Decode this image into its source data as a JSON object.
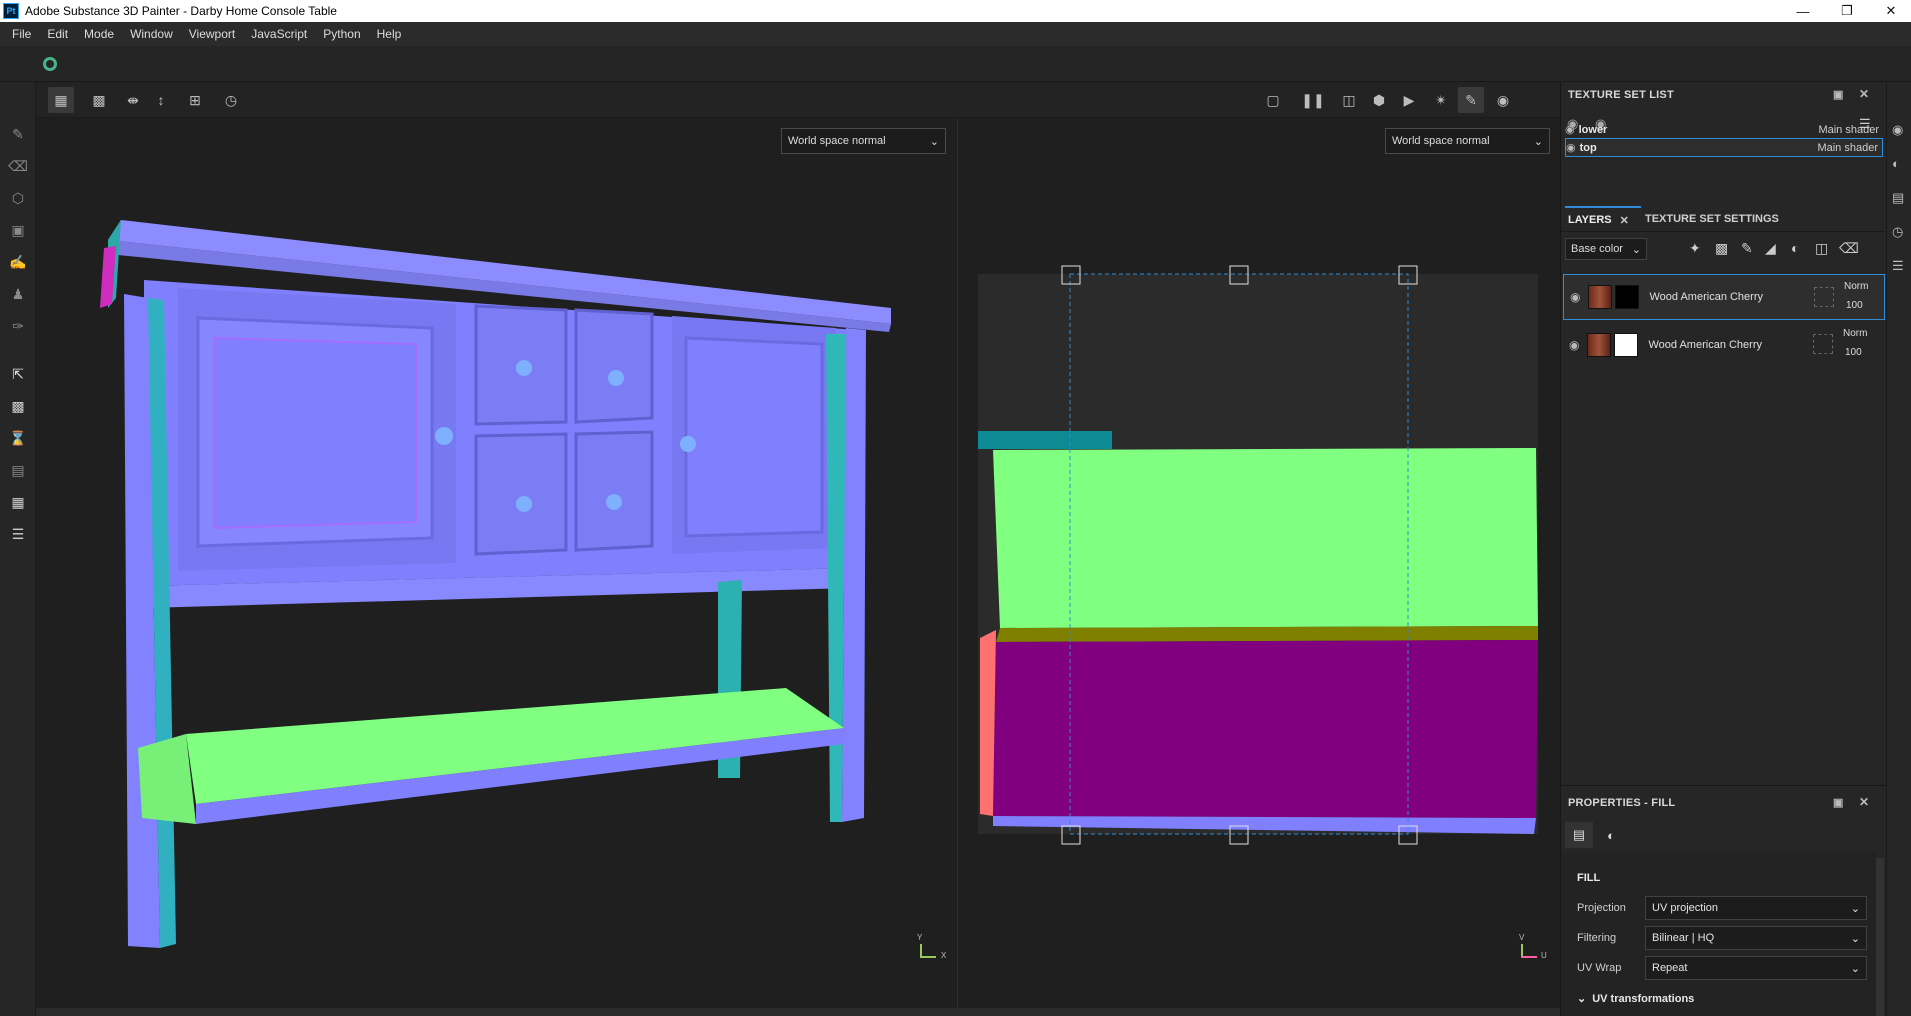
{
  "app": {
    "title": "Adobe Substance 3D Painter - Darby Home Console Table",
    "logo_text": "Pt"
  },
  "menu": [
    "File",
    "Edit",
    "Mode",
    "Window",
    "Viewport",
    "JavaScript",
    "Python",
    "Help"
  ],
  "viewports": {
    "left_mode": "World space normal",
    "right_mode": "World space normal",
    "axis_left": {
      "y": "Y",
      "x": "X"
    },
    "axis_right": {
      "y": "V",
      "x": "U"
    }
  },
  "texture_set_list": {
    "title": "TEXTURE SET LIST",
    "items": [
      {
        "name": "lower",
        "shader": "Main shader",
        "selected": false
      },
      {
        "name": "top",
        "shader": "Main shader",
        "selected": true
      }
    ]
  },
  "layers": {
    "tab_layers": "LAYERS",
    "tab_settings": "TEXTURE SET SETTINGS",
    "channel": "Base color",
    "items": [
      {
        "name": "Wood American Cherry",
        "blend": "Norm",
        "opacity": "100",
        "mask": "black",
        "selected": true
      },
      {
        "name": "Wood American Cherry",
        "blend": "Norm",
        "opacity": "100",
        "mask": "white",
        "selected": false
      }
    ]
  },
  "properties": {
    "title": "PROPERTIES - FILL",
    "section": "FILL",
    "rows": [
      {
        "label": "Projection",
        "value": "UV projection"
      },
      {
        "label": "Filtering",
        "value": "Bilinear | HQ"
      },
      {
        "label": "UV Wrap",
        "value": "Repeat"
      }
    ],
    "subsection": "UV transformations"
  },
  "colors": {
    "accent": "#2f8cd8",
    "normal_blue": "#8080ff",
    "normal_green": "#80ff80",
    "normal_purple": "#80007f"
  }
}
